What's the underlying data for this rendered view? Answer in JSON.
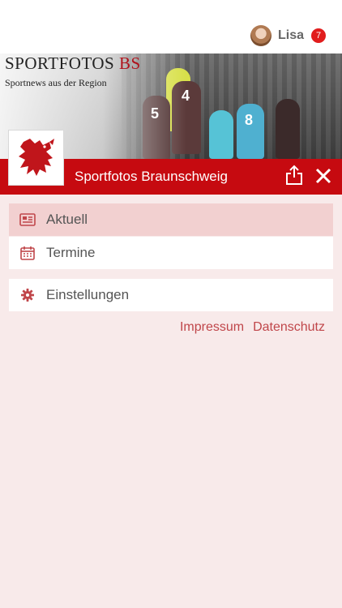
{
  "header": {
    "username": "Lisa",
    "notification_count": "7"
  },
  "banner": {
    "title_main": "SPORTFOTOS",
    "title_accent": "BS",
    "subtitle": "Sportnews aus der Region",
    "jersey_numbers": [
      "4",
      "5",
      "8"
    ]
  },
  "site_bar": {
    "title": "Sportfotos Braunschweig",
    "color": "#c60a10"
  },
  "menu": {
    "items": [
      {
        "label": "Aktuell",
        "icon": "newspaper-icon",
        "active": true
      },
      {
        "label": "Termine",
        "icon": "calendar-icon",
        "active": false
      },
      {
        "label": "Einstellungen",
        "icon": "gear-icon",
        "active": false
      }
    ]
  },
  "footer_links": {
    "impressum": "Impressum",
    "datenschutz": "Datenschutz"
  },
  "colors": {
    "accent": "#c60a10",
    "link": "#c0464a",
    "background": "#f8eaea",
    "active_item": "#f2d0d0"
  }
}
